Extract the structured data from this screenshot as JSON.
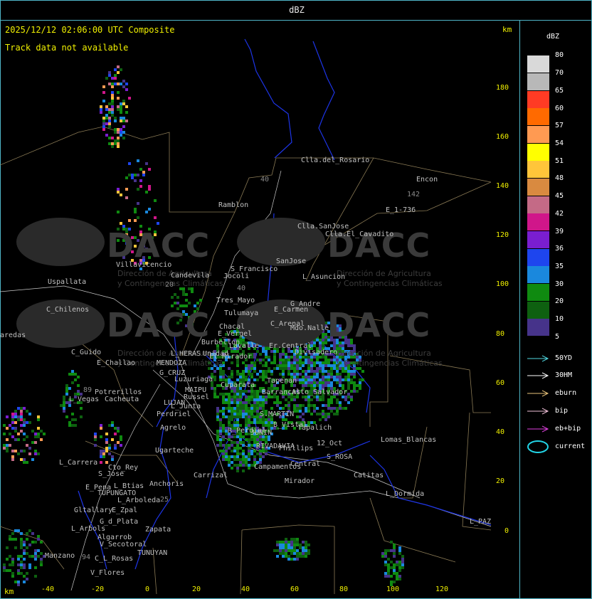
{
  "window": {
    "title": "dBZ"
  },
  "map": {
    "headline": "2025/12/12 02:06:00 UTC Composite",
    "track_message": "Track data not available",
    "axis_unit": "km",
    "y_ticks": [
      "180",
      "160",
      "140",
      "120",
      "100",
      "80",
      "60",
      "40",
      "20",
      "0"
    ],
    "x_ticks": [
      "-40",
      "-20",
      "0",
      "20",
      "40",
      "60",
      "80",
      "100",
      "120"
    ],
    "watermark": {
      "brand": "DACC",
      "line1": "Dirección de Agricultura",
      "line2": "y Contingencias Climáticas"
    },
    "places": [
      "Clla.del_Rosario",
      "Encon",
      "E_1-736",
      "Ramblon",
      "Clla.SanJose",
      "Clla.El_Cavadito",
      "Villavicencio",
      "Candevila",
      "S_Francisco",
      "SanJose",
      "L_Asuncion",
      "Uspallata",
      "Jocoli",
      "Tres_Mayo",
      "G_Andre",
      "E_Carmen",
      "C_Chilenos",
      "Tulumaya",
      "Chacal",
      "E_Vergel",
      "C_Arenal",
      "Mdo.Nalle",
      "aredas",
      "Burbellon",
      "Lavalle",
      "Er.Central",
      "Divisadero",
      "C_Guido",
      "L_HERAS",
      "Unidad",
      "E_Challao",
      "MENDOZA",
      "El_Mirador",
      "G_CRUZ",
      "Luzuriaga",
      "Cuparata",
      "Tapenan",
      "Potrerillos",
      "MAIPU",
      "Barrancas",
      "L_Vegas",
      "Cacheuta",
      "Russel",
      "Alto_Salvador",
      "LUJAN",
      "L_Junta",
      "Perdriel",
      "S.MARTIN",
      "Agrelo",
      "R_Perdiel",
      "JUNIN",
      "B_Vistal",
      "Tapalich",
      "Ugarteche",
      "RIVADAVIA",
      "Phillips",
      "12_Oct",
      "S_ROSA",
      "Lomas_Blancas",
      "L_Carrera",
      "Cto_Rey",
      "S_Jose",
      "Carrizal",
      "Campamentos",
      "Central",
      "Catitas",
      "E_Pena",
      "L_Btias",
      "Anchoris",
      "TUPUNGATO",
      "Mirador",
      "L_Dormida",
      "Gltallary",
      "E_Zpal",
      "L_Arboleda",
      "L_PAZ",
      "G_d_Plata",
      "L_Arbols",
      "Zapata",
      "Algarrob",
      "V_Secotoral",
      "TUNUYAN",
      "Manzano",
      "C_L_Rosas",
      "V_Flores"
    ],
    "routes": [
      "40",
      "142",
      "40",
      "20",
      "25",
      "94",
      "89"
    ]
  },
  "legend": {
    "title": "dBZ",
    "scale": [
      {
        "label": "80",
        "color": "#d9d9d9"
      },
      {
        "label": "70",
        "color": "#b8b8b8"
      },
      {
        "label": "65",
        "color": "#ff3b24"
      },
      {
        "label": "60",
        "color": "#ff6a00"
      },
      {
        "label": "57",
        "color": "#ff9a52"
      },
      {
        "label": "54",
        "color": "#ffff00"
      },
      {
        "label": "51",
        "color": "#ffc53a"
      },
      {
        "label": "48",
        "color": "#d98a40"
      },
      {
        "label": "45",
        "color": "#c46a86"
      },
      {
        "label": "42",
        "color": "#d0168a"
      },
      {
        "label": "39",
        "color": "#7a1ed0"
      },
      {
        "label": "36",
        "color": "#1e45ee"
      },
      {
        "label": "35",
        "color": "#1a88dd"
      },
      {
        "label": "30",
        "color": "#0f8a10"
      },
      {
        "label": "20",
        "color": "#0e6010"
      },
      {
        "label": "10",
        "color": "#46338a"
      },
      {
        "label": "5",
        "color": ""
      }
    ],
    "tracks": [
      {
        "label": "50YD",
        "color": "#4fd7e0"
      },
      {
        "label": "30HM",
        "color": "#ffffff"
      },
      {
        "label": "eburn",
        "color": "#e8c27a"
      },
      {
        "label": "bip",
        "color": "#f0c0d8"
      },
      {
        "label": "eb+bip",
        "color": "#e040e0"
      },
      {
        "label": "current",
        "color": "#22d4e6"
      }
    ]
  }
}
